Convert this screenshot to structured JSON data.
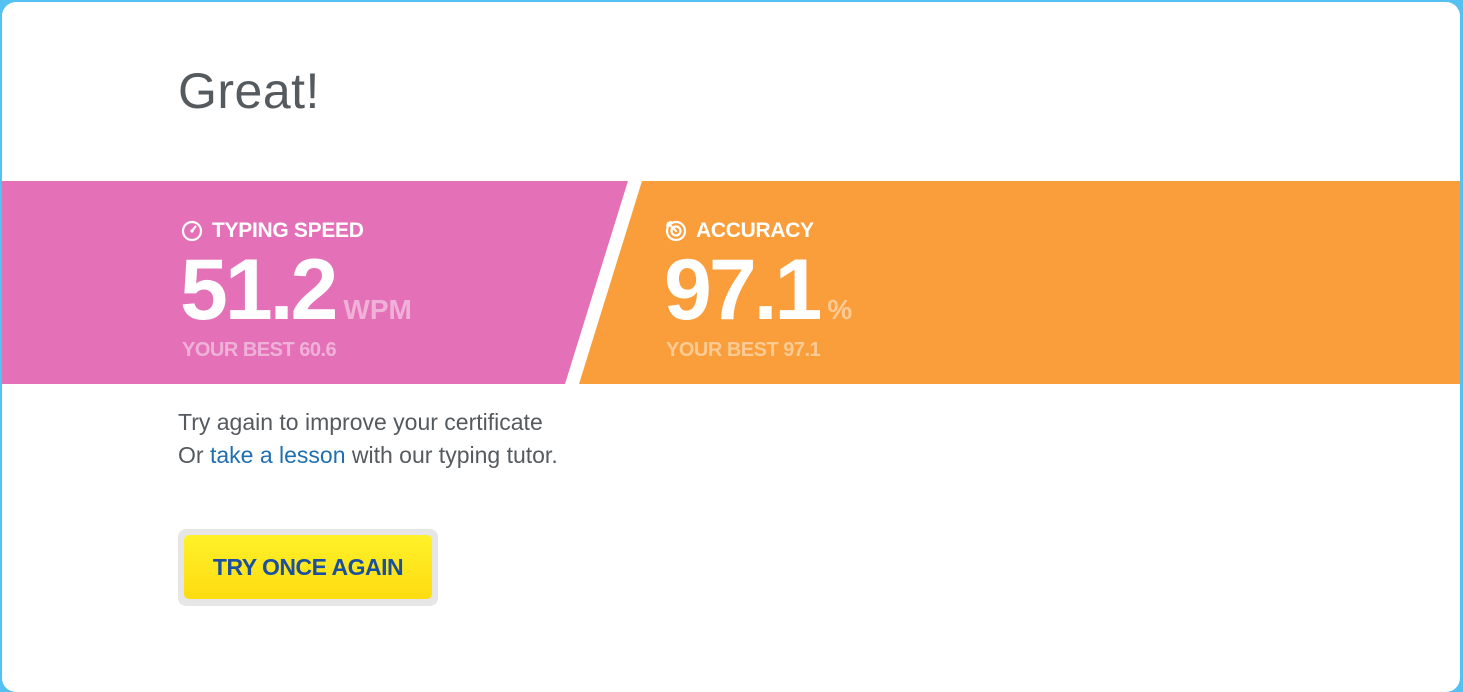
{
  "result": {
    "heading": "Great!"
  },
  "speed": {
    "icon": "speedometer-icon",
    "label": "TYPING SPEED",
    "value": "51.2",
    "unit": "WPM",
    "best": "YOUR BEST 60.6",
    "color": "#e471b8"
  },
  "accuracy": {
    "icon": "target-icon",
    "label": "ACCURACY",
    "value": "97.1",
    "unit": "%",
    "best": "YOUR BEST 97.1",
    "color": "#f99e3b"
  },
  "message": {
    "line1": "Try again to improve your certificate",
    "line2_prefix": "Or ",
    "lesson_link": "take a lesson",
    "line2_suffix": " with our typing tutor."
  },
  "actions": {
    "try_again_label": "TRY ONCE AGAIN",
    "button_color": "#fddc10"
  }
}
